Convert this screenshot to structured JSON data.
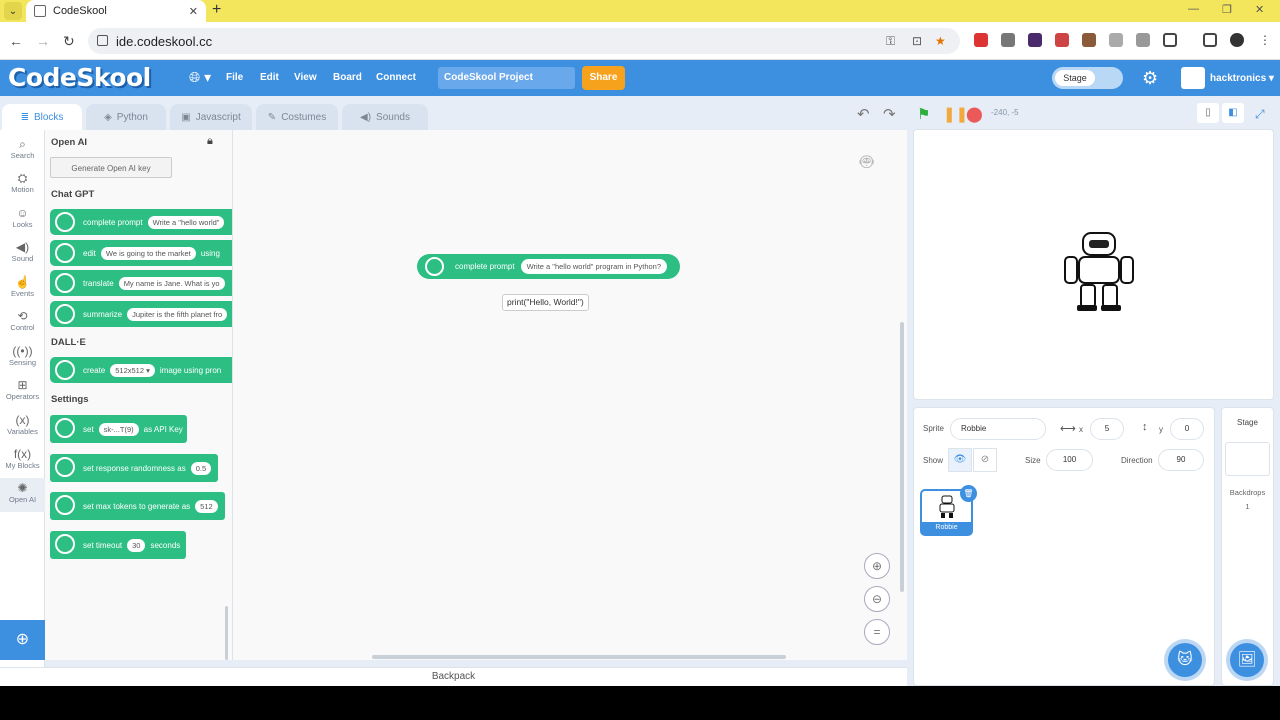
{
  "browser": {
    "tab_title": "CodeSkool",
    "url": "ide.codeskool.cc"
  },
  "app": {
    "logo": "CodeSkool",
    "menus": [
      "File",
      "Edit",
      "View",
      "Board",
      "Connect"
    ],
    "project_name": "CodeSkool Project",
    "share_label": "Share",
    "stage_toggle": "Stage",
    "user": "hacktronics"
  },
  "editor_tabs": [
    "Blocks",
    "Python",
    "Javascript",
    "Costumes",
    "Sounds"
  ],
  "coordinates": "-240, -5",
  "categories": [
    "Search",
    "Motion",
    "Looks",
    "Sound",
    "Events",
    "Control",
    "Sensing",
    "Operators",
    "Variables",
    "My Blocks",
    "Open AI"
  ],
  "palette": {
    "section_openai": "Open AI",
    "generate_key": "Generate Open AI key",
    "section_chatgpt": "Chat GPT",
    "chat_blocks": [
      {
        "label": "complete prompt",
        "input": "Write a \"hello world\""
      },
      {
        "label": "edit",
        "input": "We is going to the market",
        "suffix": "using"
      },
      {
        "label": "translate",
        "input": "My name is Jane. What is yo"
      },
      {
        "label": "summarize",
        "input": "Jupiter is the fifth planet fro"
      }
    ],
    "section_dalle": "DALL·E",
    "dalle_block": {
      "label": "create",
      "input": "512x512 ▾",
      "suffix": "image using pron"
    },
    "section_settings": "Settings",
    "settings_blocks": [
      {
        "prefix": "set",
        "input": "sk-...T(9)",
        "suffix": "as API Key"
      },
      {
        "prefix": "set response randomness as",
        "input": "0.5",
        "suffix": ""
      },
      {
        "prefix": "set max tokens to generate as",
        "input": "512",
        "suffix": ""
      },
      {
        "prefix": "set timeout",
        "input": "30",
        "suffix": "seconds"
      }
    ]
  },
  "workspace": {
    "block_label": "complete prompt",
    "block_input": "Write a \"hello world\" program in Python?",
    "tooltip": "print(\"Hello, World!\")"
  },
  "backpack": "Backpack",
  "sprite": {
    "sprite_label": "Sprite",
    "name": "Robbie",
    "x_label": "x",
    "x": "5",
    "y_label": "y",
    "y": "0",
    "show_label": "Show",
    "size_label": "Size",
    "size": "100",
    "direction_label": "Direction",
    "direction": "90",
    "thumb_name": "Robbie"
  },
  "stage_panel": {
    "title": "Stage",
    "backdrops_label": "Backdrops",
    "backdrops_count": "1"
  }
}
